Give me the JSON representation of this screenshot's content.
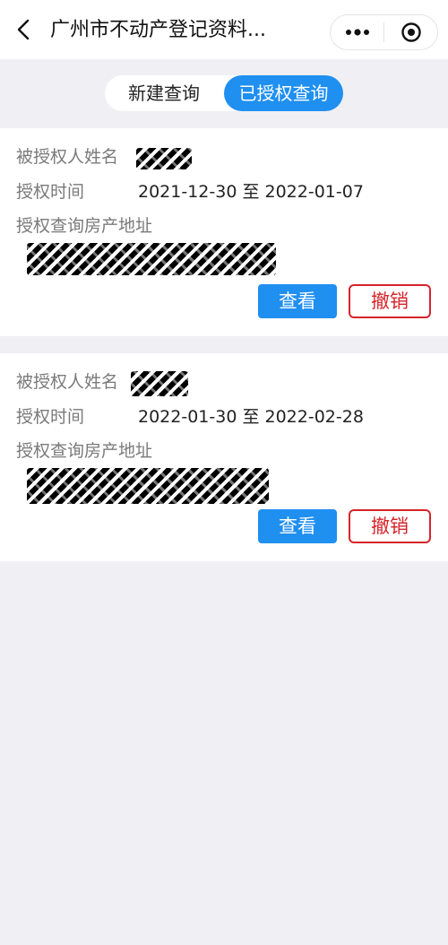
{
  "navbar": {
    "title": "广州市不动产登记资料...",
    "back_icon": "chevron-left-icon",
    "more_icon": "more-dots-icon",
    "close_icon": "target-circle-icon"
  },
  "tabs": {
    "new_query": "新建查询",
    "authorized_query": "已授权查询",
    "active": "authorized_query",
    "active_color": "#1f8ff0"
  },
  "labels": {
    "name": "被授权人姓名",
    "time": "授权时间",
    "address": "授权查询房产地址"
  },
  "records": [
    {
      "time": "2021-12-30 至 2022-01-07",
      "view_label": "查看",
      "revoke_label": "撤销"
    },
    {
      "time": "2022-01-30 至 2022-02-28",
      "view_label": "查看",
      "revoke_label": "撤销"
    }
  ],
  "colors": {
    "primary": "#1f8ff0",
    "danger": "#d6242a",
    "background": "#efeff4"
  }
}
